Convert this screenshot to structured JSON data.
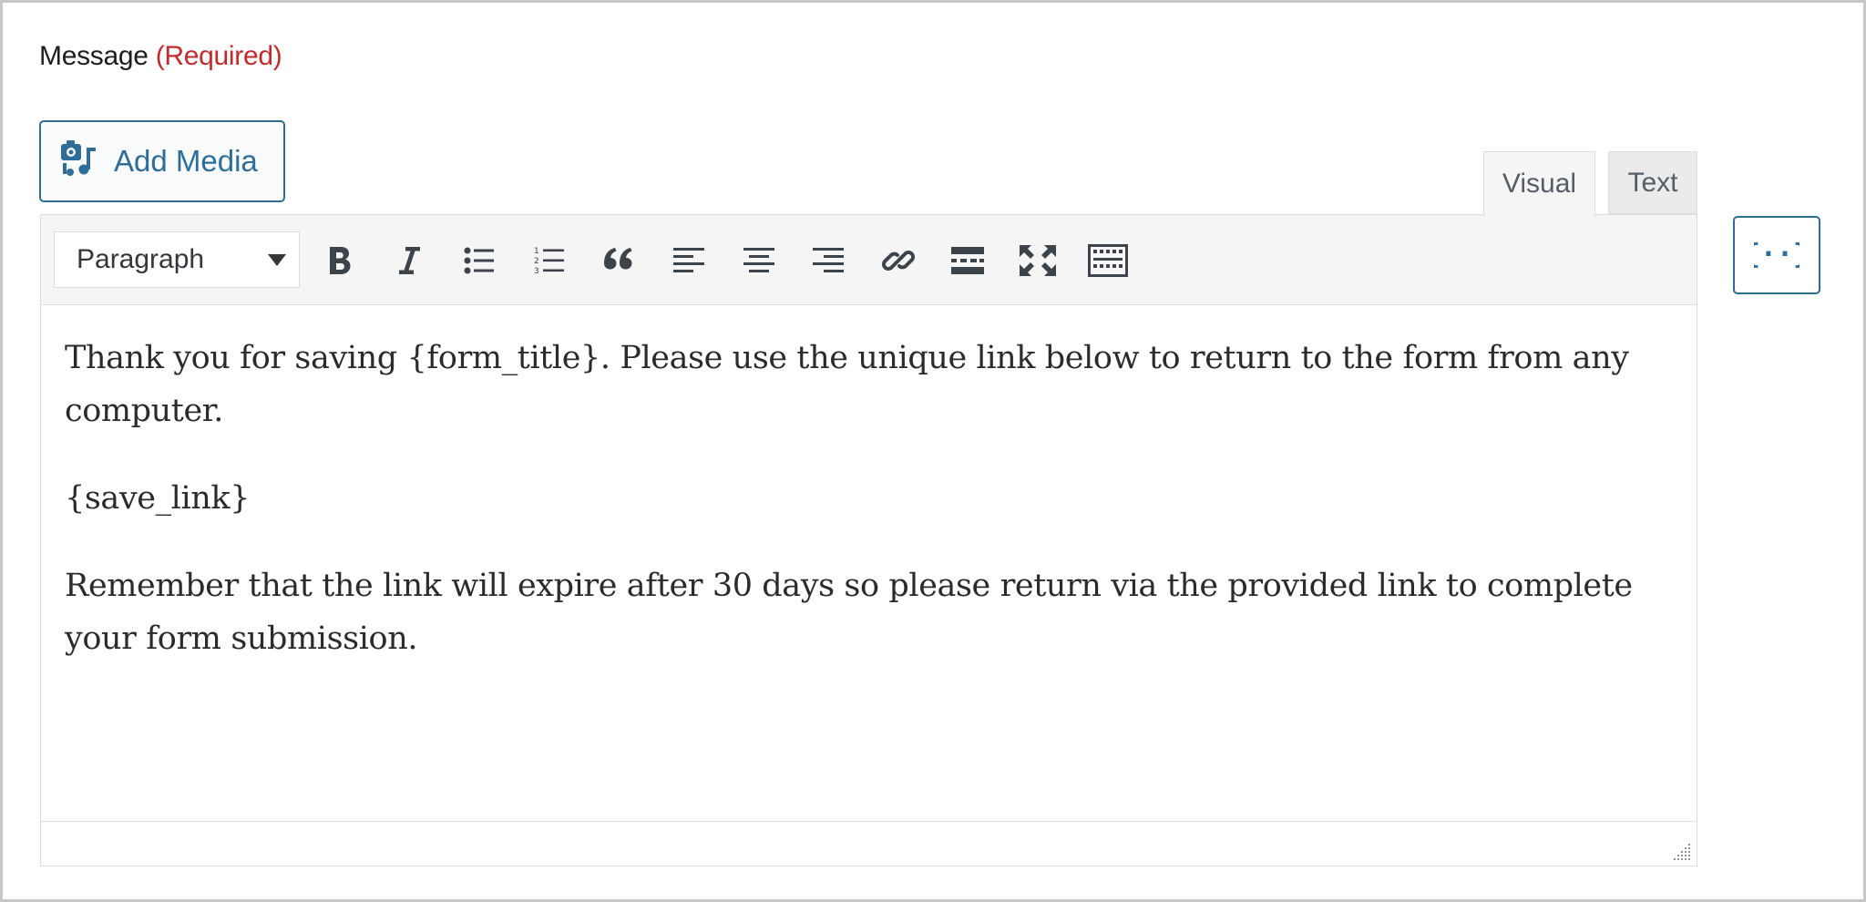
{
  "field": {
    "label": "Message",
    "required": "(Required)"
  },
  "media": {
    "add_label": "Add Media",
    "icon": "media-icon"
  },
  "tabs": [
    {
      "label": "Visual",
      "active": true
    },
    {
      "label": "Text",
      "active": false
    }
  ],
  "toolbar": {
    "format_selected": "Paragraph",
    "buttons": [
      "bold-icon",
      "italic-icon",
      "bullet-list-icon",
      "numbered-list-icon",
      "blockquote-icon",
      "align-left-icon",
      "align-center-icon",
      "align-right-icon",
      "link-icon",
      "read-more-icon",
      "fullscreen-icon",
      "toolbar-toggle-icon"
    ]
  },
  "content": {
    "paragraphs": [
      "Thank you for saving {form_title}. Please use the unique link below to return to the form from any computer.",
      "{save_link}",
      "Remember that the link will expire after 30 days so please return via the provided link to complete your form submission."
    ]
  },
  "merge_tags": {
    "icon": "merge-tags-icon"
  },
  "colors": {
    "accent": "#2f6d99",
    "required": "#c02b2b",
    "toolbar_bg": "#f5f5f5",
    "border": "#dcdcde"
  }
}
